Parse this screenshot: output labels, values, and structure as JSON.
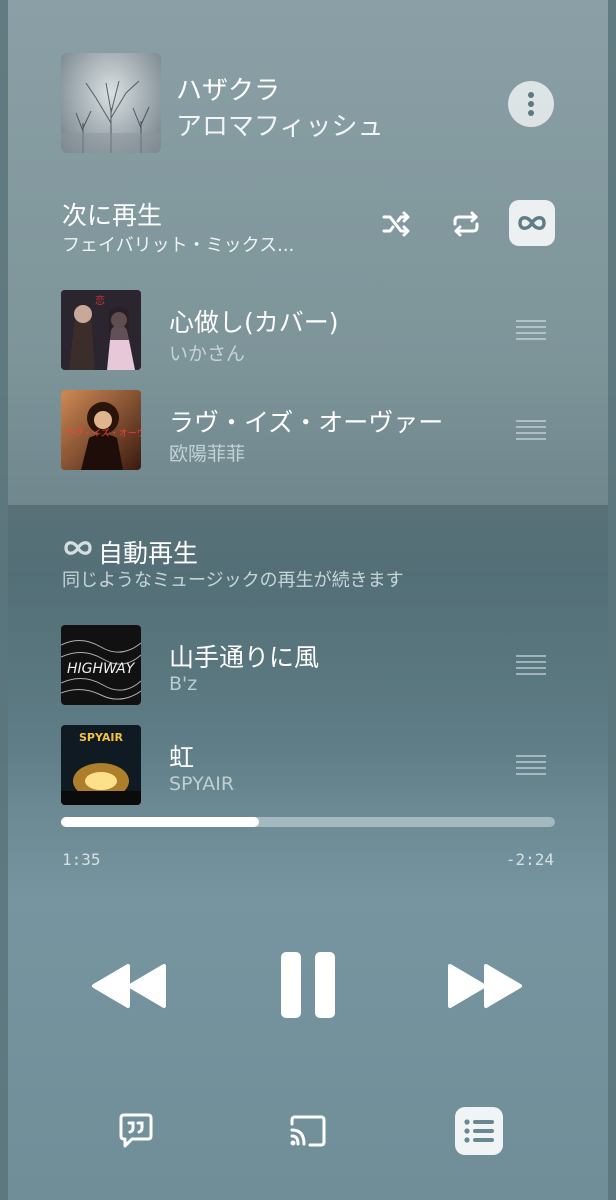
{
  "now_playing": {
    "title": "ハザクラ",
    "artist": "アロマフィッシュ",
    "more_icon": "more-vertical-icon"
  },
  "up_next": {
    "title": "次に再生",
    "subtitle": "フェイバリット・ミックス...",
    "shuffle_icon": "shuffle-icon",
    "repeat_icon": "repeat-icon",
    "autoplay_icon": "infinity-icon",
    "autoplay_active": true,
    "tracks": [
      {
        "title": "心做し(カバー)",
        "artist": "いかさん"
      },
      {
        "title": "ラヴ・イズ・オーヴァー",
        "artist": "欧陽菲菲"
      }
    ]
  },
  "autoplay": {
    "title": "自動再生",
    "subtitle": "同じようなミュージックの再生が続きます",
    "tracks": [
      {
        "title": "山手通りに風",
        "artist": "B'z"
      },
      {
        "title": "虹",
        "artist": "SPYAIR"
      }
    ]
  },
  "playback": {
    "elapsed": "1:35",
    "remaining": "-2:24",
    "progress_fraction": 0.4
  },
  "controls": {
    "rewind_icon": "rewind-icon",
    "pause_icon": "pause-icon",
    "forward_icon": "fast-forward-icon"
  },
  "bottom_bar": {
    "lyrics_icon": "lyrics-quote-icon",
    "cast_icon": "cast-icon",
    "queue_icon": "queue-list-icon",
    "queue_active": true
  },
  "colors": {
    "background": "#6f878d",
    "foreground": "#ffffff",
    "active_button_bg": "#e8eef0"
  }
}
